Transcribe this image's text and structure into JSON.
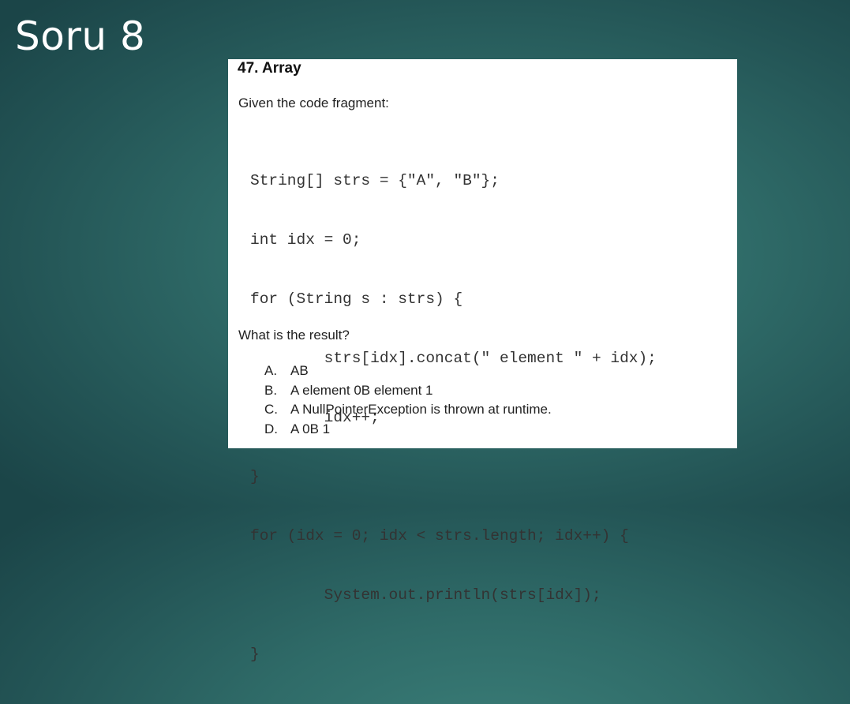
{
  "slide": {
    "title": "Soru 8"
  },
  "question": {
    "heading": "47. Array",
    "prompt": "Given the code fragment:",
    "code_lines": [
      "String[] strs = {\"A\", \"B\"};",
      "int idx = 0;",
      "for (String s : strs) {",
      "        strs[idx].concat(\" element \" + idx);",
      "        idx++;",
      "}",
      "for (idx = 0; idx < strs.length; idx++) {",
      "        System.out.println(strs[idx]);",
      "}"
    ],
    "result_prompt": "What is the result?",
    "options": [
      {
        "letter": "A.",
        "text": "AB"
      },
      {
        "letter": "B.",
        "text": "A element 0B element 1"
      },
      {
        "letter": "C.",
        "text": "A NullPointerException is thrown at runtime."
      },
      {
        "letter": "D.",
        "text": "A 0B 1"
      }
    ]
  },
  "colors": {
    "background": "#2f6b68",
    "card": "#ffffff",
    "title_text": "#ffffff"
  }
}
